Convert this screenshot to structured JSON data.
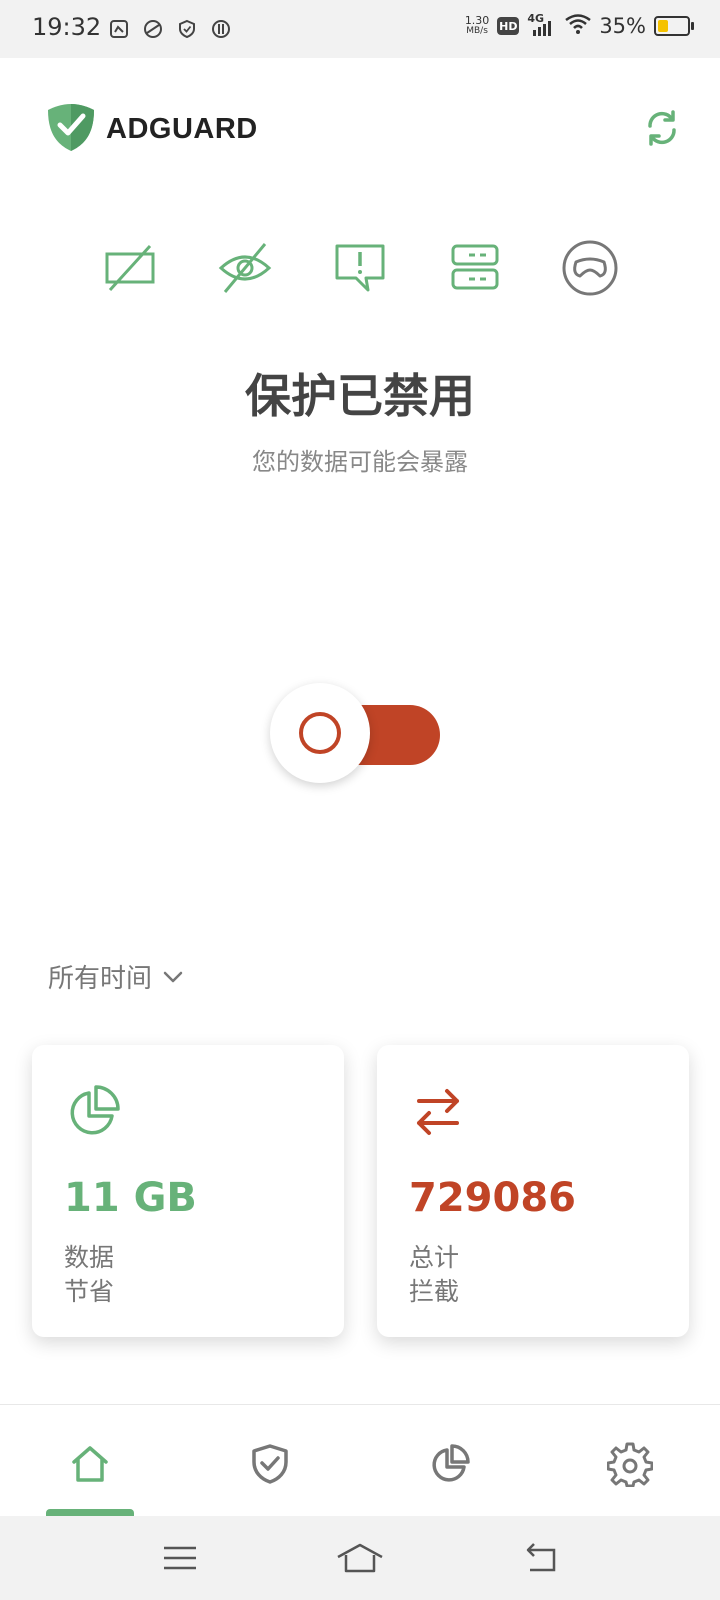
{
  "status_bar": {
    "time": "19:32",
    "net_speed_value": "1.30",
    "net_speed_unit": "MB/s",
    "hd_badge": "HD",
    "network_type": "4G",
    "battery_percent": "35%",
    "battery_level": 0.35
  },
  "header": {
    "app_name": "ADGUARD"
  },
  "features": [
    "ad-block-icon",
    "tracking-protection-icon",
    "annoyance-block-icon",
    "dns-server-icon",
    "stealth-mode-icon"
  ],
  "protection": {
    "title": "保护已禁用",
    "subtitle": "您的数据可能会暴露",
    "enabled": false
  },
  "period": {
    "selected": "所有时间"
  },
  "stats": {
    "data_saved": {
      "value": "11 GB",
      "label_line1": "数据",
      "label_line2": "节省"
    },
    "total_blocked": {
      "value": "729086",
      "label_line1": "总计",
      "label_line2": "拦截"
    }
  },
  "bottom_nav": {
    "items": [
      "home",
      "protection",
      "statistics",
      "settings"
    ],
    "active": "home"
  },
  "colors": {
    "accent_green": "#67b279",
    "accent_red": "#c04426"
  }
}
